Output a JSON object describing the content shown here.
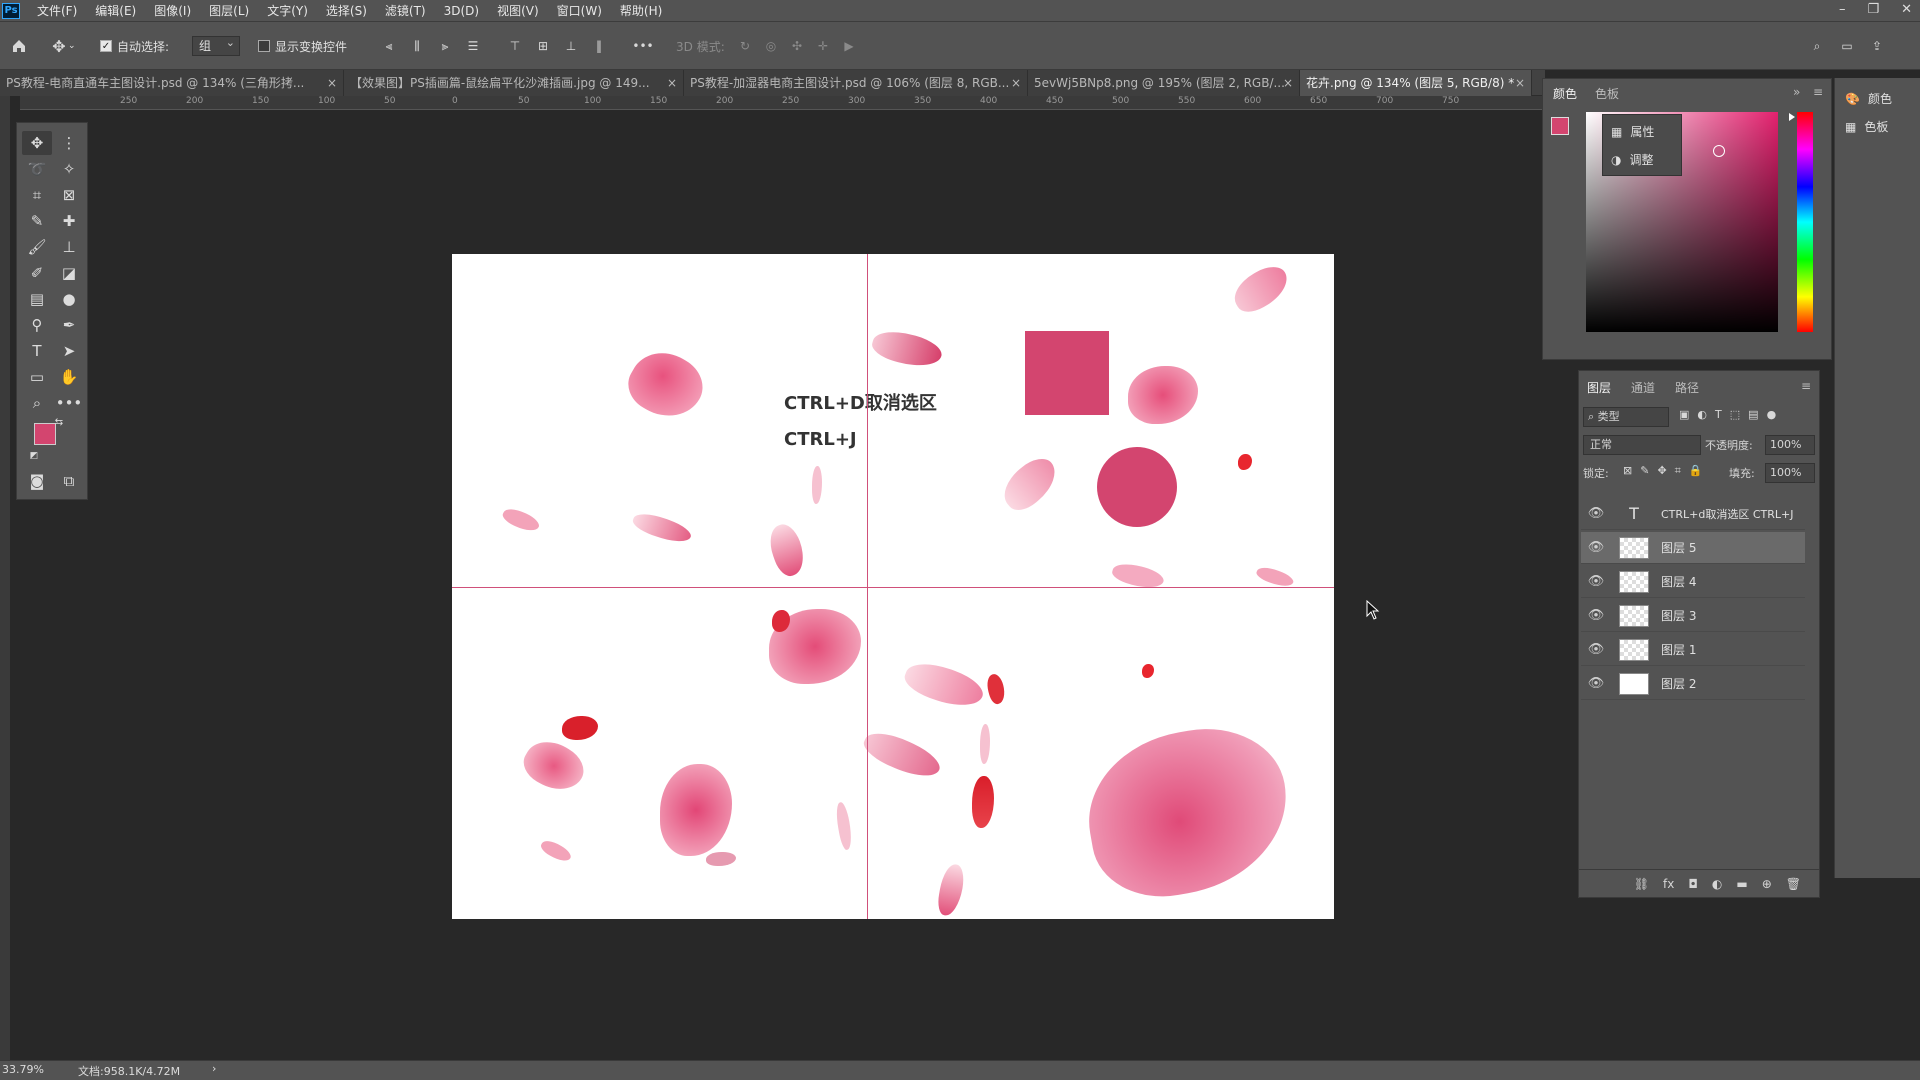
{
  "menubar": {
    "logo": "Ps",
    "items": [
      "文件(F)",
      "编辑(E)",
      "图像(I)",
      "图层(L)",
      "文字(Y)",
      "选择(S)",
      "滤镜(T)",
      "3D(D)",
      "视图(V)",
      "窗口(W)",
      "帮助(H)"
    ]
  },
  "options": {
    "auto_select_label": "自动选择:",
    "auto_select_checked": true,
    "auto_select_value": "组",
    "show_transform_label": "显示变换控件",
    "mode_3d_label": "3D 模式:"
  },
  "tabs": [
    {
      "label": "PS教程-电商直通车主图设计.psd @ 134% (三角形拷..."
    },
    {
      "label": "【效果图】PS插画篇-鼠绘扁平化沙滩插画.jpg @ 149..."
    },
    {
      "label": "PS教程-加湿器电商主图设计.psd @ 106% (图层 8, RGB..."
    },
    {
      "label": "5evWj5BNp8.png @ 195% (图层 2, RGB/..."
    },
    {
      "label": "花卉.png @ 134% (图层 5, RGB/8) *"
    }
  ],
  "ruler_ticks": [
    "250",
    "200",
    "150",
    "100",
    "50",
    "0",
    "50",
    "100",
    "150",
    "200",
    "250",
    "300",
    "350",
    "400",
    "450",
    "500",
    "550",
    "600",
    "650",
    "700",
    "750"
  ],
  "canvas": {
    "line1": "CTRL+D取消选区",
    "line2": "CTRL+J"
  },
  "color_panel": {
    "tabs": [
      "颜色",
      "色板"
    ],
    "fg_color": "#d3456f",
    "bg_color": "#ffffff",
    "menu_items": [
      "属性",
      "调整"
    ]
  },
  "side_strip": {
    "items": [
      "颜色",
      "色板"
    ]
  },
  "layers_panel": {
    "tabs": [
      "图层",
      "通道",
      "路径"
    ],
    "filter_label": "类型",
    "blend_mode": "正常",
    "opacity_label": "不透明度:",
    "opacity_value": "100%",
    "lock_label": "锁定:",
    "fill_label": "填充:",
    "fill_value": "100%",
    "layers": [
      {
        "name": "CTRL+d取消选区  CTRL+J",
        "type": "text"
      },
      {
        "name": "图层 5",
        "type": "pixel",
        "selected": true
      },
      {
        "name": "图层 4",
        "type": "pixel"
      },
      {
        "name": "图层 3",
        "type": "pixel"
      },
      {
        "name": "图层 1",
        "type": "pixel"
      },
      {
        "name": "图层 2",
        "type": "white"
      }
    ]
  },
  "status": {
    "zoom": "33.79%",
    "doc": "文档:958.1K/4.72M"
  },
  "colors": {
    "accent": "#d3456f",
    "guide": "#d0507a"
  }
}
